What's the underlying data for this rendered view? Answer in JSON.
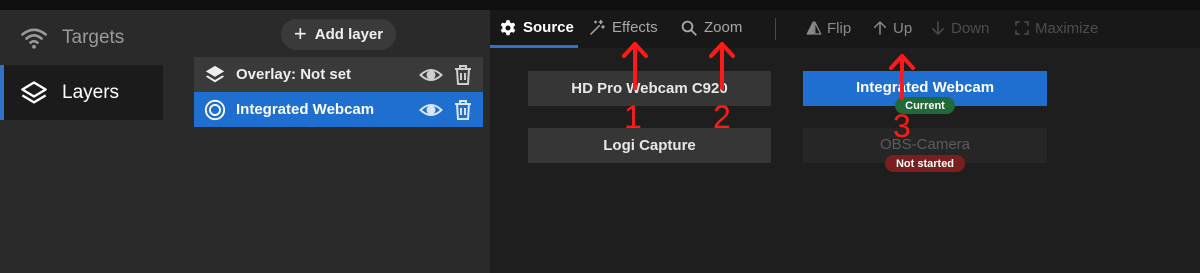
{
  "nav": {
    "items": [
      {
        "label": "Targets",
        "icon": "wifi-icon",
        "active": false
      },
      {
        "label": "Layers",
        "icon": "layers-icon",
        "active": true
      }
    ]
  },
  "layers": {
    "add_label": "Add layer",
    "items": [
      {
        "label": "Overlay: Not set",
        "icon": "layers-stack-icon",
        "selected": false
      },
      {
        "label": "Integrated Webcam",
        "icon": "webcam-ring-icon",
        "selected": true
      }
    ]
  },
  "tabs": {
    "source": "Source",
    "effects": "Effects",
    "zoom": "Zoom"
  },
  "toolbar": {
    "flip": "Flip",
    "up": "Up",
    "down": "Down",
    "maximize": "Maximize"
  },
  "sources": {
    "available": [
      "HD Pro Webcam C920",
      "Logi Capture"
    ],
    "active": [
      {
        "label": "Integrated Webcam",
        "status": "Current",
        "status_color": "#1f6a38"
      },
      {
        "label": "OBS-Camera",
        "status": "Not started",
        "status_color": "#7a1e1e"
      }
    ]
  },
  "annotations": [
    "1",
    "2",
    "3"
  ],
  "colors": {
    "accent": "#1f6fd0",
    "annotation": "#ff1a1a"
  }
}
